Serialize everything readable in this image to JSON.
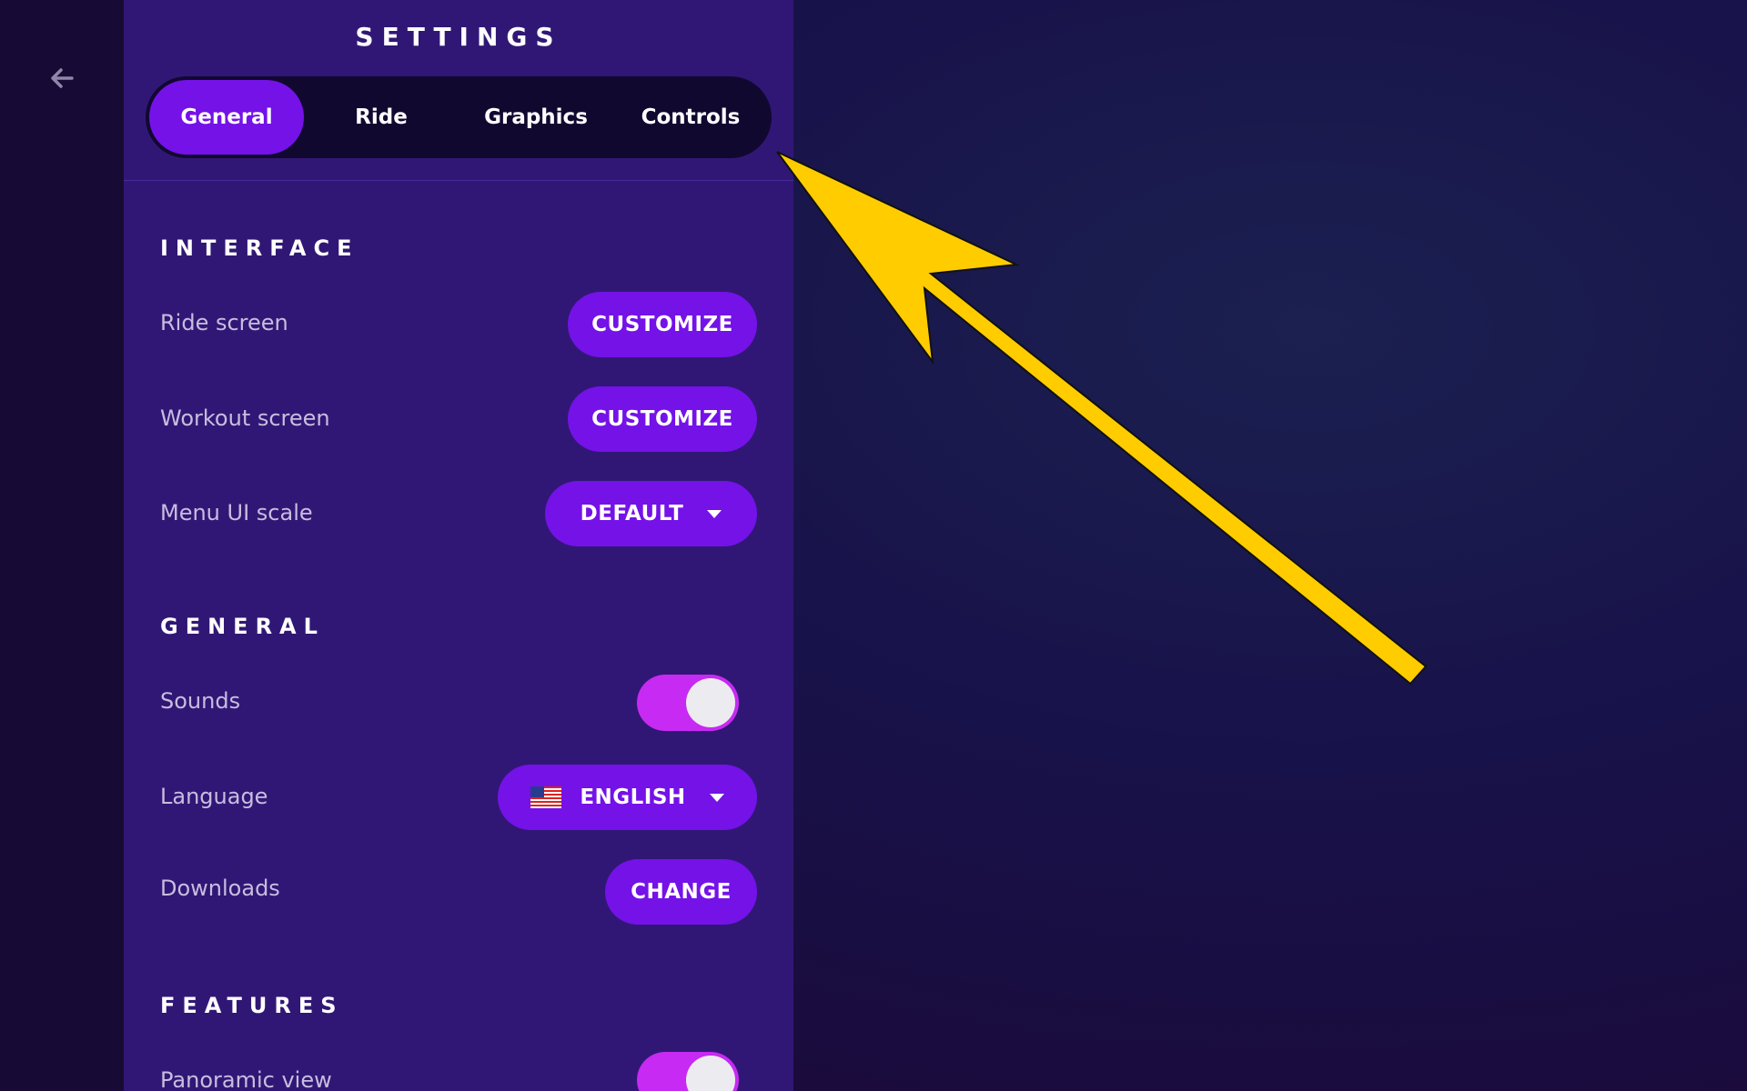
{
  "title": "SETTINGS",
  "tabs": [
    {
      "label": "General",
      "active": true
    },
    {
      "label": "Ride",
      "active": false
    },
    {
      "label": "Graphics",
      "active": false
    },
    {
      "label": "Controls",
      "active": false
    }
  ],
  "sections": {
    "interface": {
      "title": "INTERFACE",
      "ride_screen": {
        "label": "Ride screen",
        "button": "CUSTOMIZE"
      },
      "workout_screen": {
        "label": "Workout screen",
        "button": "CUSTOMIZE"
      },
      "menu_ui_scale": {
        "label": "Menu UI scale",
        "value": "DEFAULT"
      }
    },
    "general": {
      "title": "GENERAL",
      "sounds": {
        "label": "Sounds",
        "enabled": true
      },
      "language": {
        "label": "Language",
        "value": "ENGLISH"
      },
      "downloads": {
        "label": "Downloads",
        "button": "CHANGE"
      }
    },
    "features": {
      "title": "FEATURES",
      "panoramic_view": {
        "label": "Panoramic view",
        "enabled": true
      }
    }
  },
  "colors": {
    "panel": "#311775",
    "accent": "#7412e8",
    "toggle_on": "#c72af2",
    "annotation_arrow": "#ffcc00"
  },
  "icons": {
    "back": "arrow-left-icon",
    "dropdown": "caret-down-icon",
    "flag": "us-flag-icon"
  }
}
